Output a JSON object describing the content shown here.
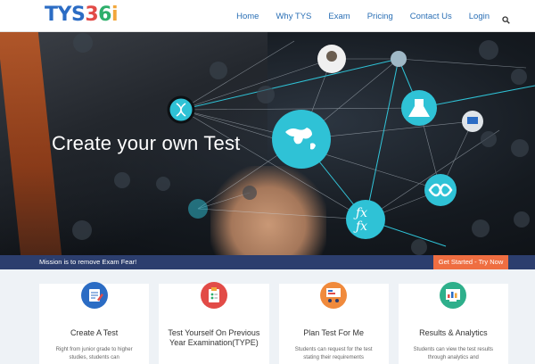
{
  "brand": {
    "logo_text": [
      "T",
      "Y",
      "S",
      "3",
      "6",
      "i"
    ],
    "logo_colors": [
      "#2b6cc4",
      "#2b6cc4",
      "#2b6cc4",
      "#e24b47",
      "#2eaf6b",
      "#f2a73b"
    ]
  },
  "nav": {
    "items": [
      "Home",
      "Why TYS",
      "Exam",
      "Pricing",
      "Contact Us",
      "Login"
    ],
    "link_color": "#2a6fb5"
  },
  "hero": {
    "title": "Create your own Test",
    "node_color": "#2fc2d6"
  },
  "mission": {
    "text": "Mission is to remove Exam Fear!",
    "cta_label": "Get Started - Try Now",
    "bar_color": "#2c3e6e",
    "cta_color": "#ef6e41"
  },
  "cards": [
    {
      "title": "Create A Test",
      "desc": "Right from junior grade to higher studies, students can",
      "icon": "create-test-icon",
      "color": "#2b6cc4"
    },
    {
      "title": "Test Yourself On Previous Year Examination(TYPE)",
      "desc": "",
      "icon": "clipboard-icon",
      "color": "#e24b47"
    },
    {
      "title": "Plan Test For Me",
      "desc": "Students can request for the test stating their requirements",
      "icon": "presentation-icon",
      "color": "#f08a3c"
    },
    {
      "title": "Results & Analytics",
      "desc": "Students can view the test results through analytics and",
      "icon": "analytics-icon",
      "color": "#2eaf8b"
    }
  ]
}
